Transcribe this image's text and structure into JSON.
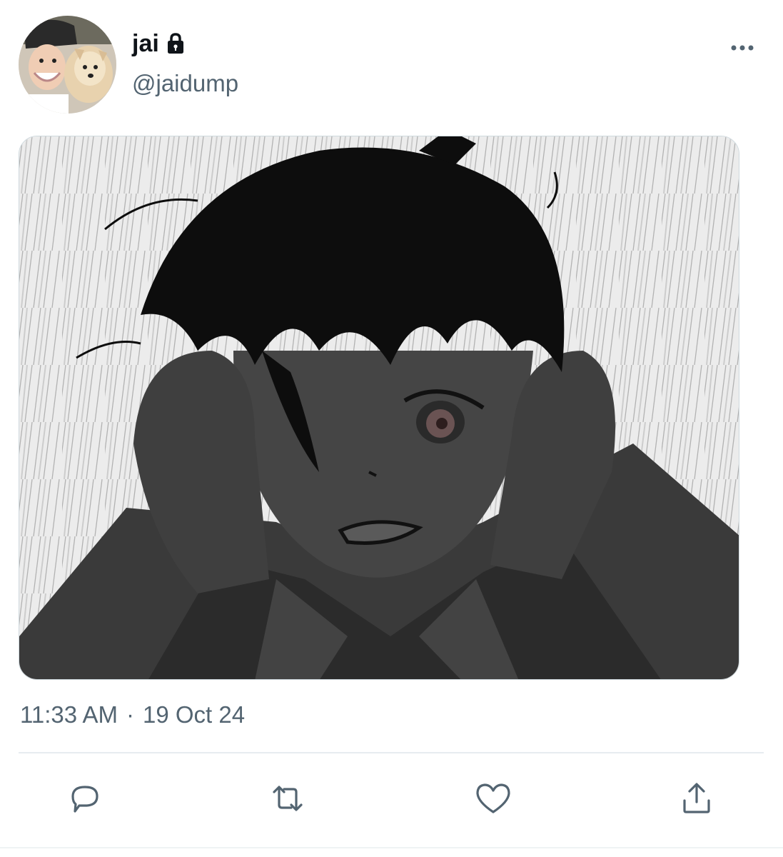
{
  "author": {
    "display_name": "jai",
    "handle": "@jaidump",
    "avatar": "profile-photo"
  },
  "header": {
    "protected_icon": "lock-icon",
    "more_icon": "more-horizontal-icon"
  },
  "media": {
    "type": "image",
    "subject": "monochrome anime drawing"
  },
  "meta": {
    "time": "11:33 AM",
    "separator": "·",
    "date": "19 Oct 24"
  },
  "actions": [
    {
      "icon": "reply-icon"
    },
    {
      "icon": "retweet-icon"
    },
    {
      "icon": "like-icon"
    },
    {
      "icon": "share-icon"
    }
  ],
  "colors": {
    "text_primary": "#0f1419",
    "text_secondary": "#536471",
    "divider": "#e7ecf0",
    "icon": "#536471"
  }
}
